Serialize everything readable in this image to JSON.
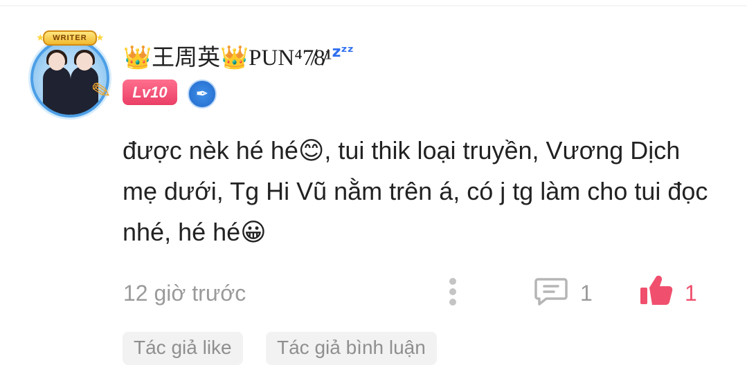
{
  "user": {
    "name": "👑王周英👑PUN⁴7̸8̸¹",
    "zzz": "zᶻᶻ",
    "level": "Lv10",
    "avatar_badge": "WRITER"
  },
  "comment": {
    "text": "được nèk hé hé😊, tui thik loại truyền, Vương Dịch mẹ dưới, Tg Hi Vũ nằm trên á, có j tg làm cho tui đọc nhé, hé hé😀"
  },
  "meta": {
    "time": "12 giờ trước",
    "reply_count": "1",
    "like_count": "1"
  },
  "tags": [
    "Tác giả like",
    "Tác giả bình luận"
  ],
  "colors": {
    "like_accent": "#f0506e",
    "level_badge": "#ea3f66",
    "writer_badge": "#2b75d4",
    "muted_text": "#9a9a9a"
  },
  "icons": [
    "writer-avatar-frame",
    "pen-nib-icon",
    "more-options-icon",
    "reply-icon",
    "thumbs-up-icon"
  ]
}
